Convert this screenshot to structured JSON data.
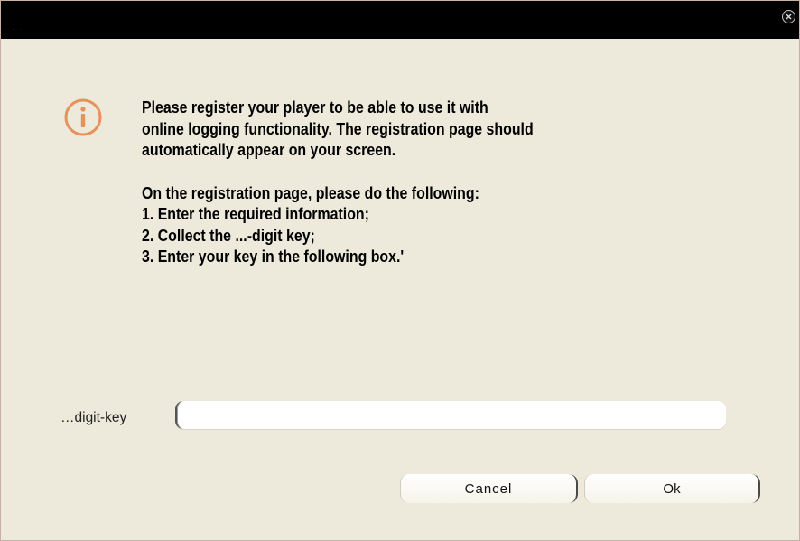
{
  "titlebar": {
    "corner_text": "· · ·",
    "close_icon": "close-circle-icon"
  },
  "dialog": {
    "icon": "info-icon",
    "accent_color": "#e8915a",
    "message_lines": [
      "Please register your player to be able to use it with",
      "online logging functionality. The registration page should",
      "automatically appear on your screen."
    ],
    "instruction_lines": [
      "On the registration page, please do the following:",
      "1. Enter the required information;",
      "2. Collect the ...-digit key;",
      "3. Enter your key in the following box.'"
    ],
    "key_label": "…digit-key",
    "key_value": "",
    "cancel_label": "Cancel",
    "ok_label": "Ok"
  }
}
